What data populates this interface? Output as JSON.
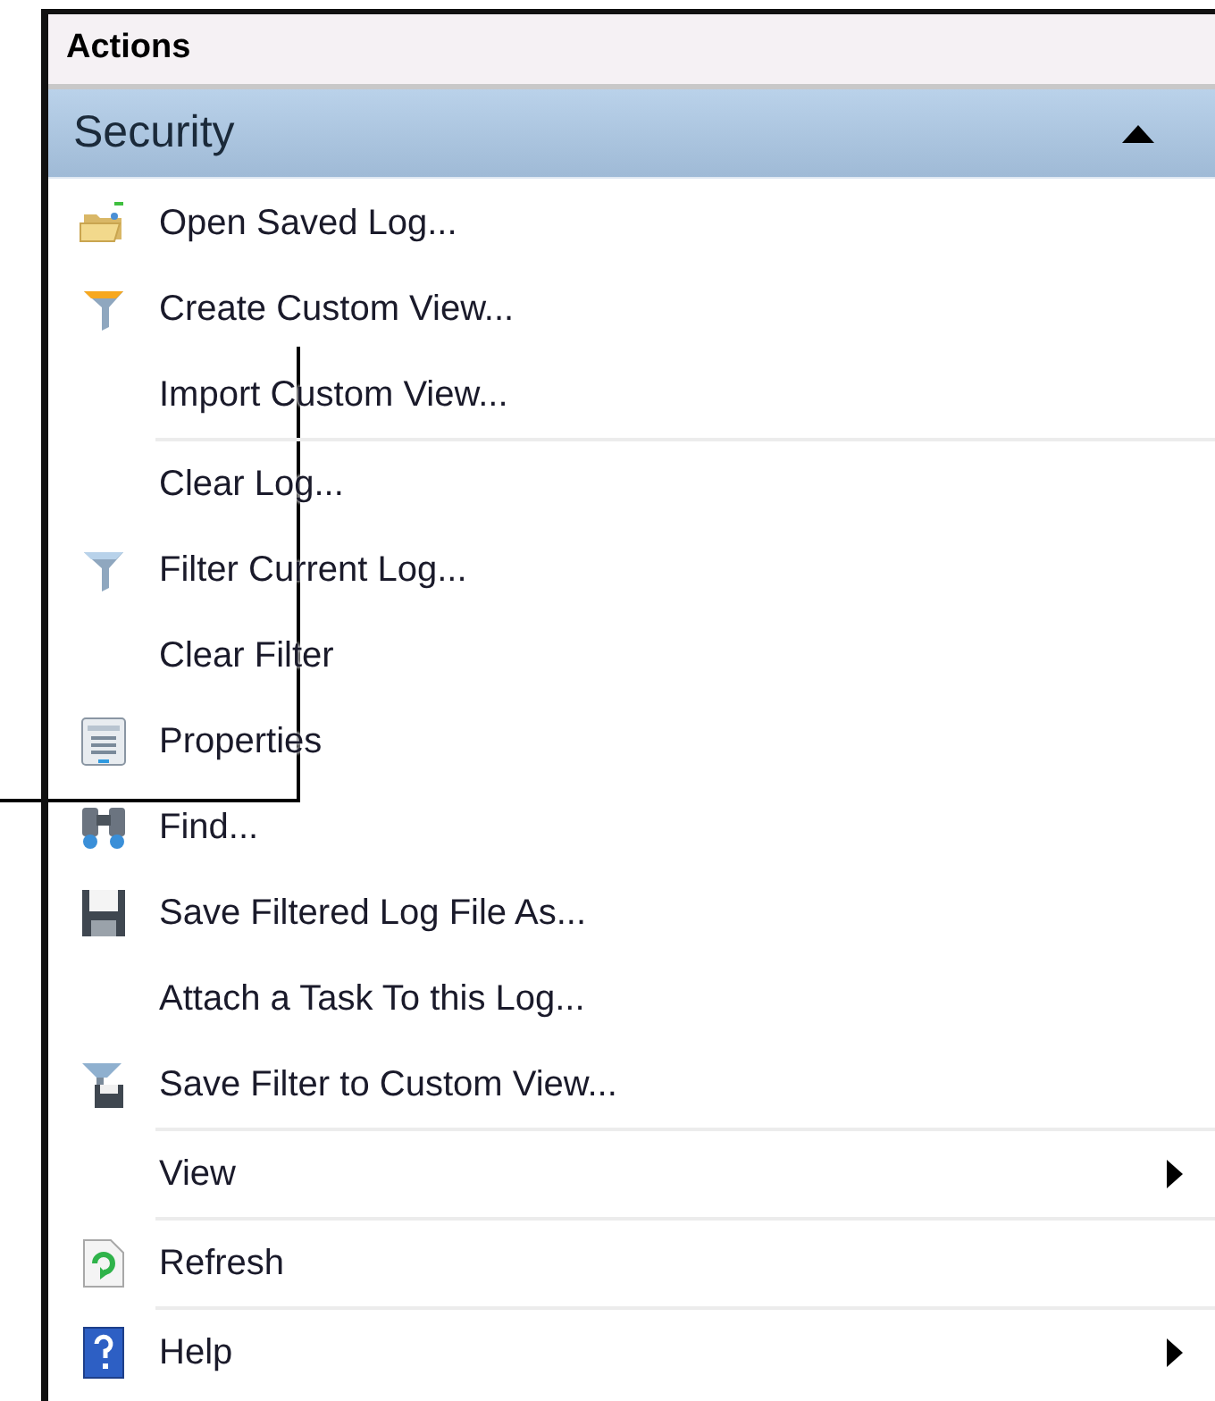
{
  "panel": {
    "title": "Actions"
  },
  "section": {
    "title": "Security",
    "expanded": true
  },
  "items": [
    {
      "kind": "item",
      "label": "Open Saved Log...",
      "submenu": false
    },
    {
      "kind": "item",
      "label": "Create Custom View...",
      "submenu": false
    },
    {
      "kind": "item",
      "label": "Import Custom View...",
      "submenu": false
    },
    {
      "kind": "separator"
    },
    {
      "kind": "item",
      "label": "Clear Log...",
      "submenu": false
    },
    {
      "kind": "item",
      "label": "Filter Current Log...",
      "submenu": false
    },
    {
      "kind": "item",
      "label": "Clear Filter",
      "submenu": false
    },
    {
      "kind": "item",
      "label": "Properties",
      "submenu": false
    },
    {
      "kind": "item",
      "label": "Find...",
      "submenu": false
    },
    {
      "kind": "item",
      "label": "Save Filtered Log File As...",
      "submenu": false
    },
    {
      "kind": "item",
      "label": "Attach a Task To this Log...",
      "submenu": false
    },
    {
      "kind": "item",
      "label": "Save Filter to Custom View...",
      "submenu": false
    },
    {
      "kind": "separator"
    },
    {
      "kind": "item",
      "label": "View",
      "submenu": true
    },
    {
      "kind": "separator"
    },
    {
      "kind": "item",
      "label": "Refresh",
      "submenu": false
    },
    {
      "kind": "separator"
    },
    {
      "kind": "item",
      "label": "Help",
      "submenu": true
    }
  ]
}
